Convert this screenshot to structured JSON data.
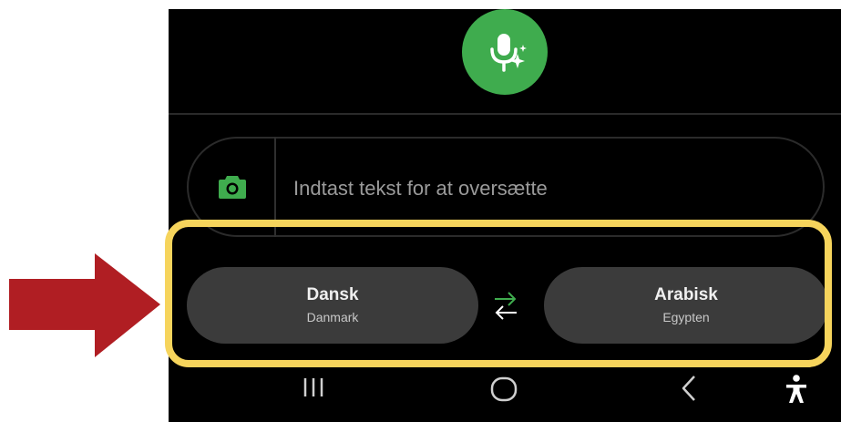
{
  "input": {
    "placeholder": "Indtast tekst for at oversætte"
  },
  "languages": {
    "source": {
      "name": "Dansk",
      "region": "Danmark"
    },
    "target": {
      "name": "Arabisk",
      "region": "Egypten"
    }
  },
  "icons": {
    "mic": "mic-sparkle-icon",
    "camera": "camera-icon",
    "swap": "swap-arrows-icon",
    "recents": "recent-apps-icon",
    "home": "home-icon",
    "back": "back-icon",
    "accessibility": "accessibility-icon"
  },
  "colors": {
    "accent_green": "#3fac4e",
    "highlight_yellow": "#f6d45c",
    "arrow_red": "#b01e23",
    "button_bg": "#3b3b3b",
    "screen_bg": "#000000"
  }
}
